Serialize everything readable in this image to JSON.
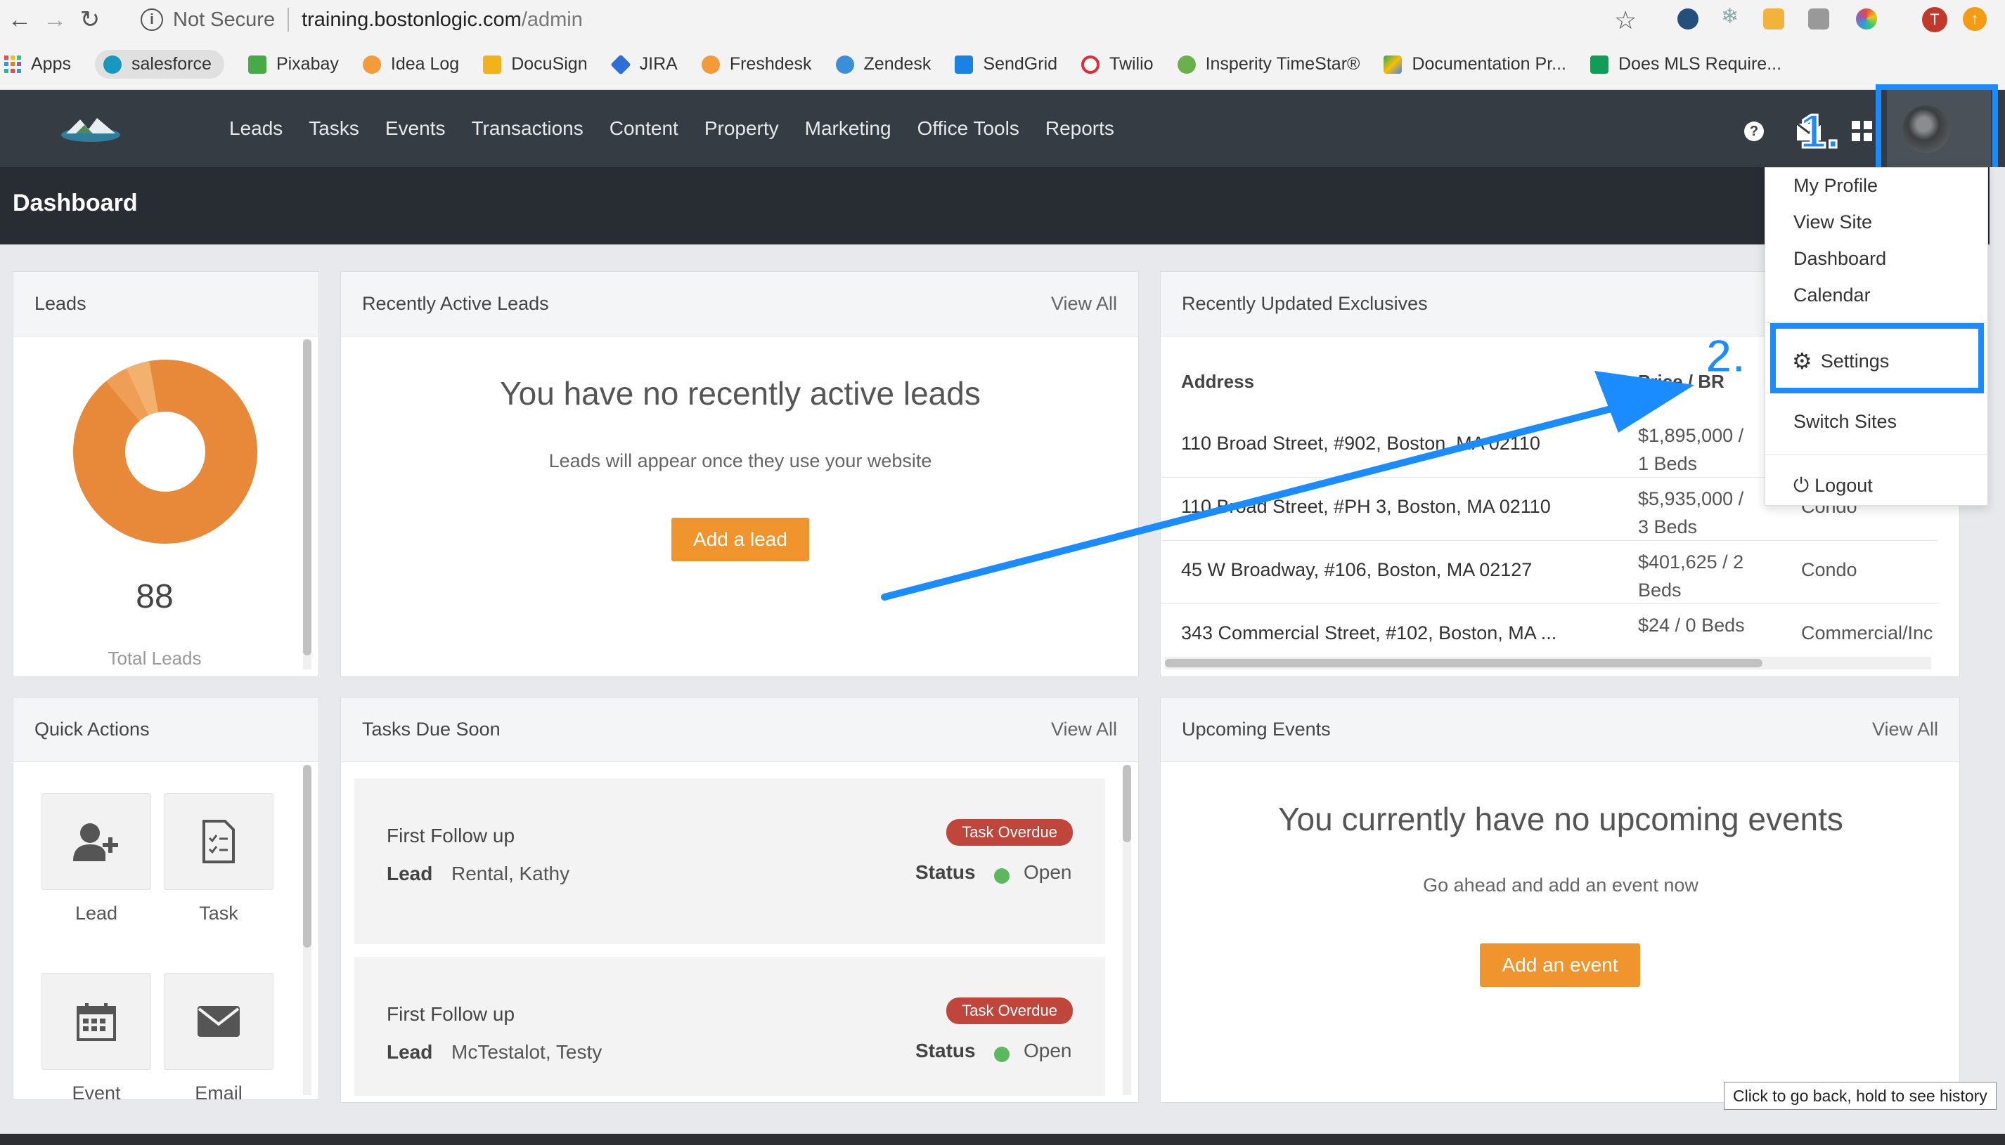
{
  "browser": {
    "security_label": "Not Secure",
    "url_host": "training.bostonlogic.com",
    "url_path": "/admin",
    "profile_initial": "T"
  },
  "bookmarks": [
    "Apps",
    "salesforce",
    "Pixabay",
    "Idea Log",
    "DocuSign",
    "JIRA",
    "Freshdesk",
    "Zendesk",
    "SendGrid",
    "Twilio",
    "Insperity TimeStar®",
    "Documentation Pr...",
    "Does MLS Require..."
  ],
  "nav": {
    "links": [
      "Leads",
      "Tasks",
      "Events",
      "Transactions",
      "Content",
      "Property",
      "Marketing",
      "Office Tools",
      "Reports"
    ],
    "help": "?"
  },
  "header": {
    "title": "Dashboard"
  },
  "leads_panel": {
    "title": "Leads",
    "count": "88",
    "count_label": "Total Leads"
  },
  "recent_leads": {
    "title": "Recently Active Leads",
    "view_all": "View All",
    "empty_title": "You have no recently active leads",
    "empty_sub": "Leads will appear once they use your website",
    "button": "Add a lead"
  },
  "exclusives": {
    "title": "Recently Updated Exclusives",
    "columns": {
      "address": "Address",
      "price": "Price / BR"
    },
    "rows": [
      {
        "address": "110 Broad Street, #902, Boston, MA 02110",
        "price": "$1,895,000 / 1 Beds",
        "type": ""
      },
      {
        "address": "110 Broad Street, #PH 3, Boston, MA 02110",
        "price": "$5,935,000 / 3 Beds",
        "type": "Condo"
      },
      {
        "address": "45 W Broadway, #106, Boston, MA 02127",
        "price": "$401,625 / 2 Beds",
        "type": "Condo"
      },
      {
        "address": "343 Commercial Street, #102, Boston, MA ...",
        "price": "$24 / 0 Beds",
        "type": "Commercial/Inc"
      }
    ]
  },
  "quick_actions": {
    "title": "Quick Actions",
    "items": [
      "Lead",
      "Task",
      "Event",
      "Email"
    ]
  },
  "tasks": {
    "title": "Tasks Due Soon",
    "view_all": "View All",
    "lead_label": "Lead",
    "status_label": "Status",
    "items": [
      {
        "title": "First Follow up",
        "lead": "Rental, Kathy",
        "badge": "Task Overdue",
        "status": "Open"
      },
      {
        "title": "First Follow up",
        "lead": "McTestalot, Testy",
        "badge": "Task Overdue",
        "status": "Open"
      }
    ]
  },
  "events": {
    "title": "Upcoming Events",
    "view_all": "View All",
    "empty_title": "You currently have no upcoming events",
    "empty_sub": "Go ahead and add an event now",
    "button": "Add an event"
  },
  "user_menu": {
    "items": [
      "My Profile",
      "View Site",
      "Dashboard",
      "Calendar",
      "Settings",
      "Switch Sites",
      "Logout"
    ]
  },
  "annotations": {
    "step1": "1.",
    "step2": "2.",
    "accent": "#1a8cff"
  },
  "tooltip": "Click to go back, hold to see history",
  "colors": {
    "nav_bg": "#353c43",
    "header_bg": "#272d33",
    "orange": "#f0952d",
    "overdue": "#c0463b",
    "open": "#5cb85c"
  }
}
